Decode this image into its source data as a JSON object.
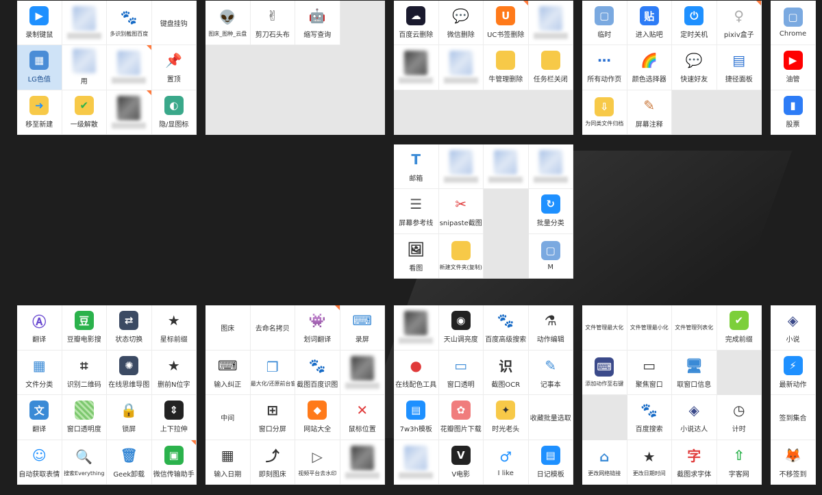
{
  "colors": {
    "background": "#1e1e1e",
    "corner_badge": "#ff7a3d",
    "empty_cell": "#e6e6e6"
  },
  "groups": [
    {
      "cols": 4,
      "rows": 3,
      "cells": [
        {
          "label": "录制键鼠",
          "icon": "video-camera-icon",
          "bg": "#1e90ff",
          "glyph": "▶"
        },
        {
          "blurred": true,
          "tone": "light"
        },
        {
          "label": "多识别截图百度",
          "icon": "baidu-paw-icon",
          "bg": "#ffffff",
          "fg": "#2932e1",
          "glyph": "🐾",
          "small": true
        },
        {
          "label": "键盘挂钩",
          "icon": "",
          "bg": "",
          "glyph": ""
        },
        {
          "label": "LG色值",
          "icon": "color-palette-icon",
          "bg": "#4a8cd6",
          "glyph": "▦",
          "selected": true
        },
        {
          "label": "用",
          "icon": "",
          "blurred_icon": true
        },
        {
          "blurred": true,
          "tone": "light",
          "corner": true
        },
        {
          "label": "置顶",
          "icon": "pin-icon",
          "bg": "#ffffff",
          "fg": "#2a70d1",
          "glyph": "📌"
        },
        {
          "label": "移至新建",
          "icon": "folder-move-icon",
          "bg": "#f7c948",
          "fg": "#1e90ff",
          "glyph": "➜"
        },
        {
          "label": "一级解散",
          "icon": "folder-check-icon",
          "bg": "#f7c948",
          "fg": "#2bb24c",
          "glyph": "✔"
        },
        {
          "blurred": true,
          "tone": "dark",
          "corner": true
        },
        {
          "label": "隐/显图标",
          "icon": "screen-toggle-icon",
          "bg": "#3aa88a",
          "glyph": "◐"
        }
      ]
    },
    {
      "cols": 4,
      "rows": 3,
      "cells": [
        {
          "label": "图床_图种_云盘",
          "icon": "alien-icon",
          "bg": "#ffffff",
          "fg": "#555",
          "glyph": "👽",
          "small": true
        },
        {
          "label": "剪刀石头布",
          "icon": "hand-icon",
          "bg": "#ffffff",
          "fg": "#555",
          "glyph": "✌"
        },
        {
          "label": "缩写查询",
          "icon": "robot-icon",
          "bg": "#ffffff",
          "fg": "#e03a3a",
          "glyph": "🤖"
        },
        {
          "empty": true
        },
        {
          "empty": true
        },
        {
          "empty": true
        },
        {
          "empty": true
        },
        {
          "empty": true
        },
        {
          "empty": true
        },
        {
          "empty": true
        },
        {
          "empty": true
        },
        {
          "empty": true
        }
      ]
    },
    {
      "cols": 4,
      "rows": 3,
      "cells": [
        {
          "label": "百度云删除",
          "icon": "baidu-cloud-icon",
          "bg": "#1a1a2e",
          "glyph": "☁"
        },
        {
          "label": "微信删除",
          "icon": "wechat-icon",
          "bg": "#ffffff",
          "fg": "#2bb24c",
          "glyph": "💬"
        },
        {
          "label": "UC书签删除",
          "icon": "uc-browser-icon",
          "bg": "#ff7a1a",
          "glyph": "U",
          "corner": true
        },
        {
          "blurred": true,
          "tone": "light"
        },
        {
          "blurred": true,
          "tone": "dark"
        },
        {
          "blurred": true,
          "tone": "light"
        },
        {
          "label": "牛管理删除",
          "icon": "folder-icon",
          "bg": "#f7c948",
          "glyph": ""
        },
        {
          "label": "任务栏关闭",
          "icon": "folder-icon",
          "bg": "#f7c948",
          "glyph": ""
        },
        {
          "empty": true
        },
        {
          "empty": true
        },
        {
          "empty": true
        },
        {
          "empty": true
        }
      ]
    },
    {
      "cols": 4,
      "rows": 3,
      "cells": [
        {
          "label": "临时",
          "icon": "window-icon",
          "bg": "#7aa9e0",
          "glyph": "▢"
        },
        {
          "label": "进入贴吧",
          "icon": "tieba-icon",
          "bg": "#2d7cf6",
          "glyph": "贴"
        },
        {
          "label": "定时关机",
          "icon": "power-icon",
          "bg": "#1e90ff",
          "glyph": "⏻"
        },
        {
          "label": "pixiv盒子",
          "icon": "anime-girl-icon",
          "bg": "#ffffff",
          "fg": "#aaa",
          "glyph": "♀",
          "corner": true
        },
        {
          "label": "所有动作页",
          "icon": "grid-dots-icon",
          "bg": "#ffffff",
          "fg": "#2a70d1",
          "glyph": "⋯"
        },
        {
          "label": "颜色选择器",
          "icon": "rainbow-icon",
          "bg": "#ffffff",
          "fg": "#e8643a",
          "glyph": "🌈"
        },
        {
          "label": "快速好友",
          "icon": "wechat-icon",
          "bg": "#ffffff",
          "fg": "#2bb24c",
          "glyph": "💬"
        },
        {
          "label": "捷径面板",
          "icon": "panel-icon",
          "bg": "#ffffff",
          "fg": "#2a70d1",
          "glyph": "▤"
        },
        {
          "label": "为同类文件归档",
          "icon": "folder-zip-icon",
          "bg": "#f7c948",
          "glyph": "⇩",
          "small": true
        },
        {
          "label": "屏幕注释",
          "icon": "easel-icon",
          "bg": "#ffffff",
          "fg": "#c9773a",
          "glyph": "✎"
        },
        {
          "empty": true
        },
        {
          "empty": true
        }
      ]
    },
    {
      "cols": 1,
      "rows": 3,
      "cells": [
        {
          "label": "Chrome",
          "icon": "window-icon",
          "bg": "#7aa9e0",
          "glyph": "▢"
        },
        {
          "label": "油管",
          "icon": "youtube-icon",
          "bg": "#ff0000",
          "glyph": "▶"
        },
        {
          "label": "股票",
          "icon": "bar-chart-icon",
          "bg": "#2d7cf6",
          "glyph": "▮"
        }
      ]
    },
    {
      "cols": 4,
      "rows": 3,
      "cells": [
        {
          "label": "邮箱",
          "icon": "text-t-icon",
          "bg": "#ffffff",
          "fg": "#3a8ad6",
          "glyph": "T"
        },
        {
          "blurred": true,
          "tone": "light"
        },
        {
          "blurred": true,
          "tone": "light"
        },
        {
          "blurred": true,
          "tone": "light"
        },
        {
          "label": "屏幕参考线",
          "icon": "lines-icon",
          "bg": "#ffffff",
          "fg": "#555",
          "glyph": "☰"
        },
        {
          "label": "snipaste截图",
          "icon": "snipaste-icon",
          "bg": "#ffffff",
          "fg": "#e03a3a",
          "glyph": "✂"
        },
        {
          "empty": true
        },
        {
          "label": "批量分类",
          "icon": "refresh-circle-icon",
          "bg": "#1e90ff",
          "glyph": "↻"
        },
        {
          "label": "看图",
          "icon": "image-icon",
          "bg": "#ffffff",
          "fg": "#333",
          "glyph": "🖼"
        },
        {
          "label": "新建文件夹(复制)",
          "icon": "folder-icon",
          "bg": "#f7c948",
          "glyph": "",
          "small": true
        },
        {
          "empty": true
        },
        {
          "label": "M",
          "icon": "window-icon",
          "bg": "#7aa9e0",
          "glyph": "▢"
        }
      ]
    },
    {
      "cols": 4,
      "rows": 4,
      "cells": [
        {
          "label": "翻译",
          "icon": "letter-a-circle-icon",
          "bg": "#ffffff",
          "fg": "#6b4bd1",
          "glyph": "Ⓐ"
        },
        {
          "label": "豆瓣电影搜",
          "icon": "douban-icon",
          "bg": "#2bb24c",
          "glyph": "豆"
        },
        {
          "label": "状态切换",
          "icon": "toggle-switch-icon",
          "bg": "#3b4a63",
          "glyph": "⇄"
        },
        {
          "label": "星标前缀",
          "icon": "star-icon",
          "bg": "#ffffff",
          "fg": "#333",
          "glyph": "★"
        },
        {
          "label": "文件分类",
          "icon": "file-grid-icon",
          "bg": "#ffffff",
          "fg": "#3a8ad6",
          "glyph": "▦"
        },
        {
          "label": "识别二维码",
          "icon": "qr-scan-icon",
          "bg": "#ffffff",
          "fg": "#333",
          "glyph": "⌗"
        },
        {
          "label": "在线思维导图",
          "icon": "mindmap-icon",
          "bg": "#3b4a63",
          "glyph": "✺"
        },
        {
          "label": "删前N位字",
          "icon": "star-icon",
          "bg": "#ffffff",
          "fg": "#333",
          "glyph": "★"
        },
        {
          "label": "翻译",
          "icon": "translate-icon",
          "bg": "#3a8ad6",
          "glyph": "文"
        },
        {
          "label": "窗口透明度",
          "icon": "gradient-grid-icon",
          "bg": "pattern",
          "glyph": ""
        },
        {
          "label": "锁屏",
          "icon": "lock-icon",
          "bg": "#ffffff",
          "fg": "#333",
          "glyph": "🔒"
        },
        {
          "label": "上下拉伸",
          "icon": "stretch-vertical-icon",
          "bg": "#222",
          "glyph": "⇕"
        },
        {
          "label": "自动获取表情",
          "icon": "smiley-icon",
          "bg": "#ffffff",
          "fg": "#1e90ff",
          "glyph": "☺"
        },
        {
          "label": "搜索Everything",
          "icon": "magnifier-icon",
          "bg": "#ffffff",
          "fg": "#e8782a",
          "glyph": "🔍",
          "small": true
        },
        {
          "label": "Geek卸载",
          "icon": "trash-icon",
          "bg": "#ffffff",
          "fg": "#3a8ad6",
          "glyph": "🗑"
        },
        {
          "label": "微信传输助手",
          "icon": "folder-green-icon",
          "bg": "#2bb24c",
          "glyph": "▣",
          "corner": true
        }
      ]
    },
    {
      "cols": 4,
      "rows": 4,
      "cells": [
        {
          "label": "图床",
          "icon": "",
          "bg": "",
          "glyph": ""
        },
        {
          "label": "去命名拷贝",
          "icon": "",
          "bg": "",
          "glyph": ""
        },
        {
          "label": "划词翻译",
          "icon": "robot-icon",
          "bg": "#ffffff",
          "fg": "#555",
          "glyph": "👾",
          "corner": true
        },
        {
          "label": "录屏",
          "icon": "keyboard-icon",
          "bg": "#ffffff",
          "fg": "#3a8ad6",
          "glyph": "⌨"
        },
        {
          "label": "输入纠正",
          "icon": "keyboard-icon",
          "bg": "#ffffff",
          "fg": "#333",
          "glyph": "⌨"
        },
        {
          "label": "最大化/还原前台窗口",
          "icon": "windows-stack-icon",
          "bg": "#ffffff",
          "fg": "#3a8ad6",
          "glyph": "❐",
          "small": true
        },
        {
          "label": "截图百度识图",
          "icon": "baidu-paw-icon",
          "bg": "#ffffff",
          "fg": "#2932e1",
          "glyph": "🐾"
        },
        {
          "blurred": true,
          "tone": "dark"
        },
        {
          "label": "中间",
          "icon": "",
          "bg": "",
          "glyph": ""
        },
        {
          "label": "窗口分屏",
          "icon": "split-window-icon",
          "bg": "#ffffff",
          "fg": "#333",
          "glyph": "⊞"
        },
        {
          "label": "网站大全",
          "icon": "tiles-icon",
          "bg": "#ff7a1a",
          "glyph": "◆"
        },
        {
          "label": "鼠标位置",
          "icon": "close-box-icon",
          "bg": "#ffffff",
          "fg": "#e03a3a",
          "glyph": "✕"
        },
        {
          "label": "输入日期",
          "icon": "calendar-icon",
          "bg": "#ffffff",
          "fg": "#333",
          "glyph": "▦"
        },
        {
          "label": "即刻图床",
          "icon": "chart-line-icon",
          "bg": "#ffffff",
          "fg": "#333",
          "glyph": "⤴"
        },
        {
          "label": "视频平台去水印",
          "icon": "video-file-icon",
          "bg": "#ffffff",
          "fg": "#555",
          "glyph": "▷",
          "small": true
        },
        {
          "blurred": true,
          "tone": "dark"
        }
      ]
    },
    {
      "cols": 4,
      "rows": 4,
      "cells": [
        {
          "blurred": true,
          "tone": "dark"
        },
        {
          "label": "天山调亮度",
          "icon": "color-wheel-icon",
          "bg": "#222",
          "glyph": "◉"
        },
        {
          "label": "百度高级搜索",
          "icon": "baidu-paw-icon",
          "bg": "#ffffff",
          "fg": "#2932e1",
          "glyph": "🐾"
        },
        {
          "label": "动作编辑",
          "icon": "flask-icon",
          "bg": "#ffffff",
          "fg": "#333",
          "glyph": "⚗"
        },
        {
          "label": "在线配色工具",
          "icon": "rgb-circles-icon",
          "bg": "#ffffff",
          "fg": "#e03a3a",
          "glyph": "●"
        },
        {
          "label": "窗口透明",
          "icon": "window-icon",
          "bg": "#ffffff",
          "fg": "#3a8ad6",
          "glyph": "▭"
        },
        {
          "label": "截图OCR",
          "icon": "ocr-icon",
          "bg": "#ffffff",
          "fg": "#333",
          "glyph": "识"
        },
        {
          "label": "记事本",
          "icon": "notepad-icon",
          "bg": "#ffffff",
          "fg": "#3a8ad6",
          "glyph": "✎"
        },
        {
          "label": "7w3h模板",
          "icon": "notebook-icon",
          "bg": "#1e90ff",
          "glyph": "▤"
        },
        {
          "label": "花瓣图片下载",
          "icon": "petal-icon",
          "bg": "#f07d7d",
          "glyph": "✿"
        },
        {
          "label": "时光老头",
          "icon": "compass-icon",
          "bg": "#f7c948",
          "fg": "#333",
          "glyph": "✦"
        },
        {
          "label": "收藏批量选取",
          "icon": "",
          "bg": "",
          "glyph": ""
        },
        {
          "blurred": true,
          "tone": "light"
        },
        {
          "label": "V电影",
          "icon": "v-movie-icon",
          "bg": "#222",
          "glyph": "V"
        },
        {
          "label": "I like",
          "icon": "male-symbol-icon",
          "bg": "#ffffff",
          "fg": "#1e90ff",
          "glyph": "♂"
        },
        {
          "label": "日记模板",
          "icon": "notebook-icon",
          "bg": "#1e90ff",
          "glyph": "▤"
        }
      ]
    },
    {
      "cols": 4,
      "rows": 4,
      "cells": [
        {
          "label": "文件管理最大化",
          "icon": "",
          "bg": "",
          "glyph": "",
          "small": true
        },
        {
          "label": "文件管理最小化",
          "icon": "",
          "bg": "",
          "glyph": "",
          "small": true
        },
        {
          "label": "文件管理列表化",
          "icon": "",
          "bg": "",
          "glyph": "",
          "small": true
        },
        {
          "label": "完成前缀",
          "icon": "checkbox-green-icon",
          "bg": "#7ccf3a",
          "glyph": "✔"
        },
        {
          "label": "添加动作至右键",
          "icon": "keyboard-blue-icon",
          "bg": "#3b4a8a",
          "glyph": "⌨",
          "small": true
        },
        {
          "label": "聚焦窗口",
          "icon": "rect-outline-icon",
          "bg": "#ffffff",
          "fg": "#333",
          "glyph": "▭"
        },
        {
          "label": "取窗口信息",
          "icon": "computer-icon",
          "bg": "#ffffff",
          "fg": "#3a8ad6",
          "glyph": "🖥"
        },
        {
          "empty": true
        },
        {
          "empty": true
        },
        {
          "label": "百度搜索",
          "icon": "baidu-paw-icon",
          "bg": "#ffffff",
          "fg": "#2932e1",
          "glyph": "🐾"
        },
        {
          "label": "小说达人",
          "icon": "book-stack-icon",
          "bg": "#ffffff",
          "fg": "#3b4a8a",
          "glyph": "◈"
        },
        {
          "label": "计时",
          "icon": "clock-icon",
          "bg": "#ffffff",
          "fg": "#333",
          "glyph": "◷"
        },
        {
          "label": "更改网络链接",
          "icon": "network-icon",
          "bg": "#ffffff",
          "fg": "#3a8ad6",
          "glyph": "⌂",
          "small": true
        },
        {
          "label": "更改日期时间",
          "icon": "star-icon",
          "bg": "#ffffff",
          "fg": "#333",
          "glyph": "★",
          "small": true
        },
        {
          "label": "截图求字体",
          "icon": "font-circle-icon",
          "bg": "#ffffff",
          "fg": "#e03a3a",
          "glyph": "字"
        },
        {
          "label": "字客网",
          "icon": "arrow-up-icon",
          "bg": "#ffffff",
          "fg": "#2bb24c",
          "glyph": "⇧"
        }
      ]
    },
    {
      "cols": 1,
      "rows": 4,
      "cells": [
        {
          "label": "小说",
          "icon": "book-stack-icon",
          "bg": "#ffffff",
          "fg": "#3b4a8a",
          "glyph": "◈"
        },
        {
          "label": "最新动作",
          "icon": "lightning-icon",
          "bg": "#1e90ff",
          "glyph": "⚡"
        },
        {
          "label": "签到集合",
          "icon": "",
          "bg": "",
          "glyph": ""
        },
        {
          "label": "不移签到",
          "icon": "fox-icon",
          "bg": "#ffffff",
          "fg": "#e8643a",
          "glyph": "🦊"
        }
      ]
    }
  ]
}
